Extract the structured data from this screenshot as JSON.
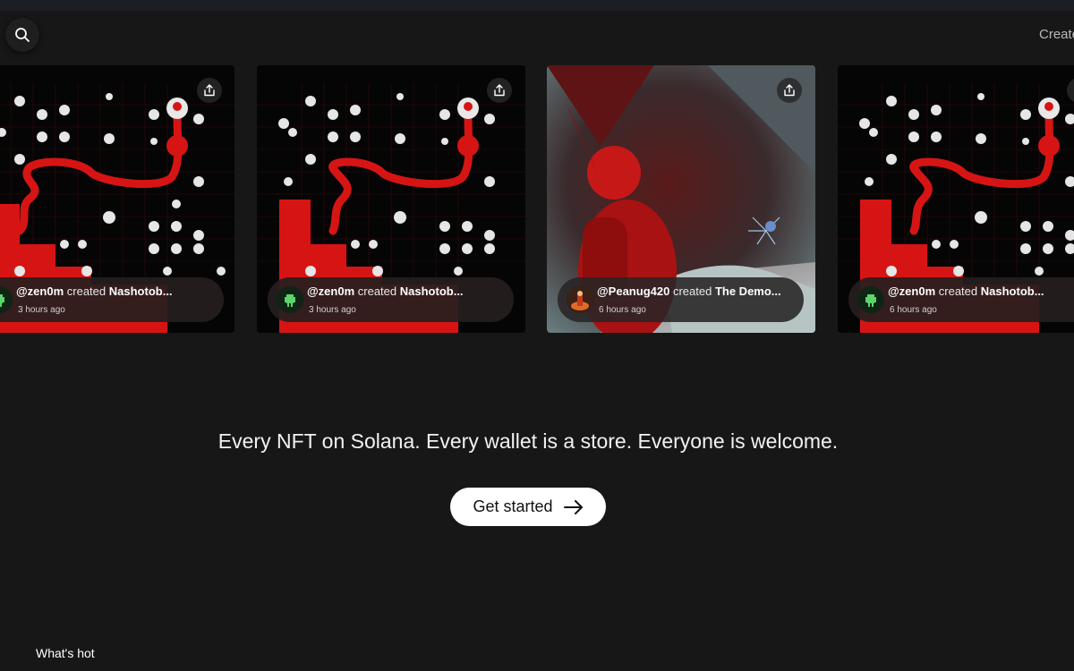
{
  "header": {
    "search_icon": "search-icon",
    "create_label": "Create"
  },
  "feed": [
    {
      "user": "@zen0m",
      "verb": "created",
      "title": "Nashotob...",
      "time": "3 hours ago",
      "art": "red-black-pixel-map"
    },
    {
      "user": "@zen0m",
      "verb": "created",
      "title": "Nashotob...",
      "time": "3 hours ago",
      "art": "red-black-pixel-map"
    },
    {
      "user": "@Peanug420",
      "verb": "created",
      "title": "The Demo...",
      "time": "6 hours ago",
      "art": "red-cave-render"
    },
    {
      "user": "@zen0m",
      "verb": "created",
      "title": "Nashotob...",
      "time": "6 hours ago",
      "art": "red-black-pixel-map"
    }
  ],
  "hero": {
    "tagline": "Every NFT on Solana. Every wallet is a store. Everyone is welcome.",
    "cta_label": "Get started"
  },
  "sections": {
    "whats_hot": "What's hot"
  },
  "colors": {
    "background": "#171717",
    "accent_red": "#d71414",
    "cta_bg": "#ffffff"
  }
}
